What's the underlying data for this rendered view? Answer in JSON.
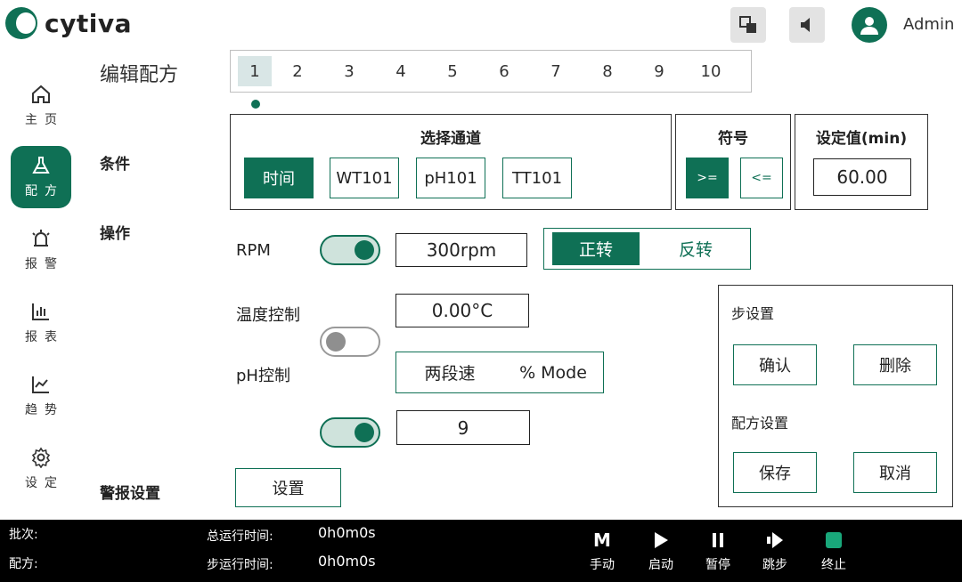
{
  "brand": {
    "name": "cytiva",
    "accent": "#0f7055"
  },
  "header": {
    "user": "Admin",
    "icons": [
      "translate-icon",
      "sound-icon",
      "user-icon"
    ]
  },
  "sidebar": {
    "items": [
      {
        "label": "主页",
        "icon": "home-icon"
      },
      {
        "label": "配方",
        "icon": "flask-icon"
      },
      {
        "label": "报警",
        "icon": "alarm-icon"
      },
      {
        "label": "报表",
        "icon": "report-icon"
      },
      {
        "label": "趋势",
        "icon": "trend-icon"
      },
      {
        "label": "设定",
        "icon": "gear-icon"
      }
    ],
    "active": "配方"
  },
  "editor": {
    "title": "编辑配方",
    "steps": [
      "1",
      "2",
      "3",
      "4",
      "5",
      "6",
      "7",
      "8",
      "9",
      "10"
    ],
    "active_step": "1"
  },
  "condition": {
    "label": "条件",
    "channel_title": "选择通道",
    "channels": [
      "时间",
      "WT101",
      "pH101",
      "TT101"
    ],
    "selected_channel": "时间",
    "symbol_title": "符号",
    "symbols": [
      ">=",
      "<="
    ],
    "selected_symbol": ">=",
    "setpoint_title": "设定值(min)",
    "setpoint_value": "60.00"
  },
  "operation": {
    "label": "操作",
    "rpm_label": "RPM",
    "rpm_on": true,
    "rpm_value": "300rpm",
    "directions": [
      "正转",
      "反转"
    ],
    "selected_direction": "正转",
    "temp_label": "温度控制",
    "temp_on": false,
    "temp_value": "0.00°C",
    "ph_label": "pH控制",
    "ph_on": true,
    "ph_modes": [
      "两段速",
      "% Mode"
    ],
    "ph_value": "9"
  },
  "alarm": {
    "label": "警报设置",
    "button": "设置"
  },
  "step_panel": {
    "step_title": "步设置",
    "confirm": "确认",
    "delete": "删除",
    "recipe_title": "配方设置",
    "save": "保存",
    "cancel": "取消"
  },
  "footer": {
    "batch_label": "批次:",
    "recipe_label": "配方:",
    "total_time_label": "总运行时间:",
    "total_time": "0h0m0s",
    "step_time_label": "步运行时间:",
    "step_time": "0h0m0s",
    "controls": [
      {
        "label": "手动",
        "icon": "manual-icon"
      },
      {
        "label": "启动",
        "icon": "play-icon"
      },
      {
        "label": "暂停",
        "icon": "pause-icon"
      },
      {
        "label": "跳步",
        "icon": "skip-icon"
      },
      {
        "label": "终止",
        "icon": "stop-icon"
      }
    ]
  }
}
